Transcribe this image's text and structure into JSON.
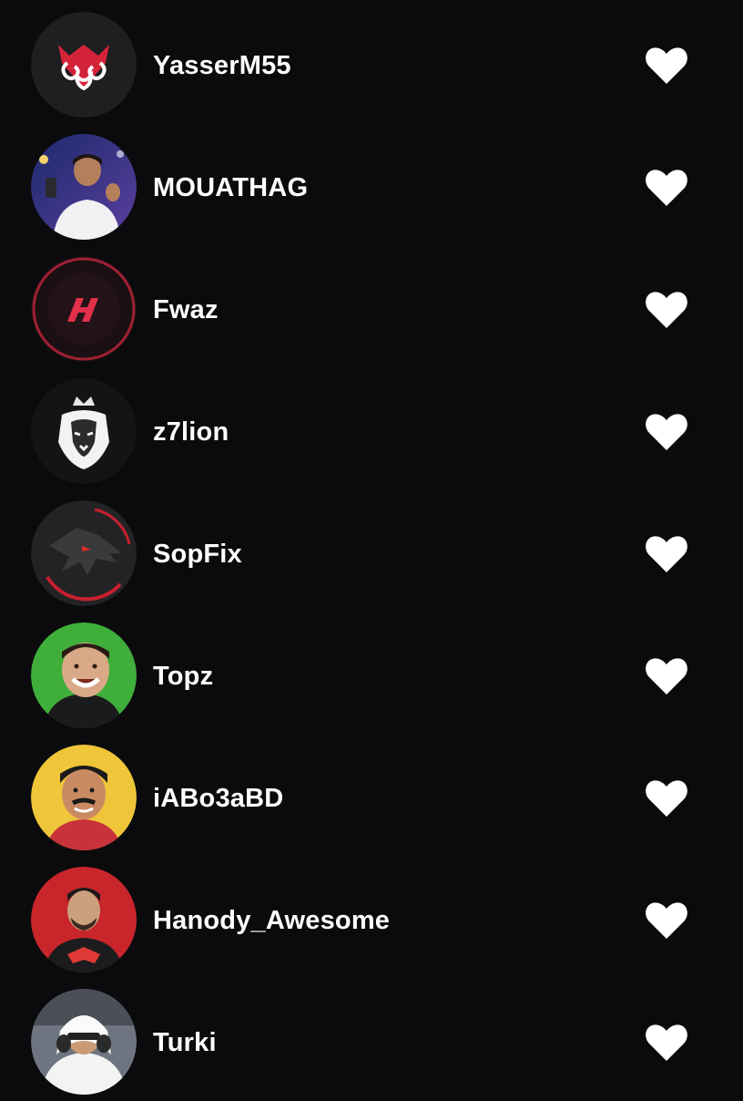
{
  "followers": [
    {
      "username": "YasserM55",
      "avatar_icon": "red-mask-logo-icon",
      "liked": true
    },
    {
      "username": "MOUATHAG",
      "avatar_icon": "person-photo-icon",
      "liked": true
    },
    {
      "username": "Fwaz",
      "avatar_icon": "red-h-logo-icon",
      "liked": true
    },
    {
      "username": "z7lion",
      "avatar_icon": "lion-crown-logo-icon",
      "liked": true
    },
    {
      "username": "SopFix",
      "avatar_icon": "dragon-logo-icon",
      "liked": true
    },
    {
      "username": "Topz",
      "avatar_icon": "person-photo-icon",
      "liked": true
    },
    {
      "username": "iABo3aBD",
      "avatar_icon": "cartoon-person-icon",
      "liked": true
    },
    {
      "username": "Hanody_Awesome",
      "avatar_icon": "cartoon-person-icon",
      "liked": true
    },
    {
      "username": "Turki",
      "avatar_icon": "person-photo-icon",
      "liked": true
    }
  ],
  "colors": {
    "background": "#0b0b0d",
    "text": "#ffffff",
    "heart": "#ffffff",
    "accent_red": "#d4243a"
  }
}
